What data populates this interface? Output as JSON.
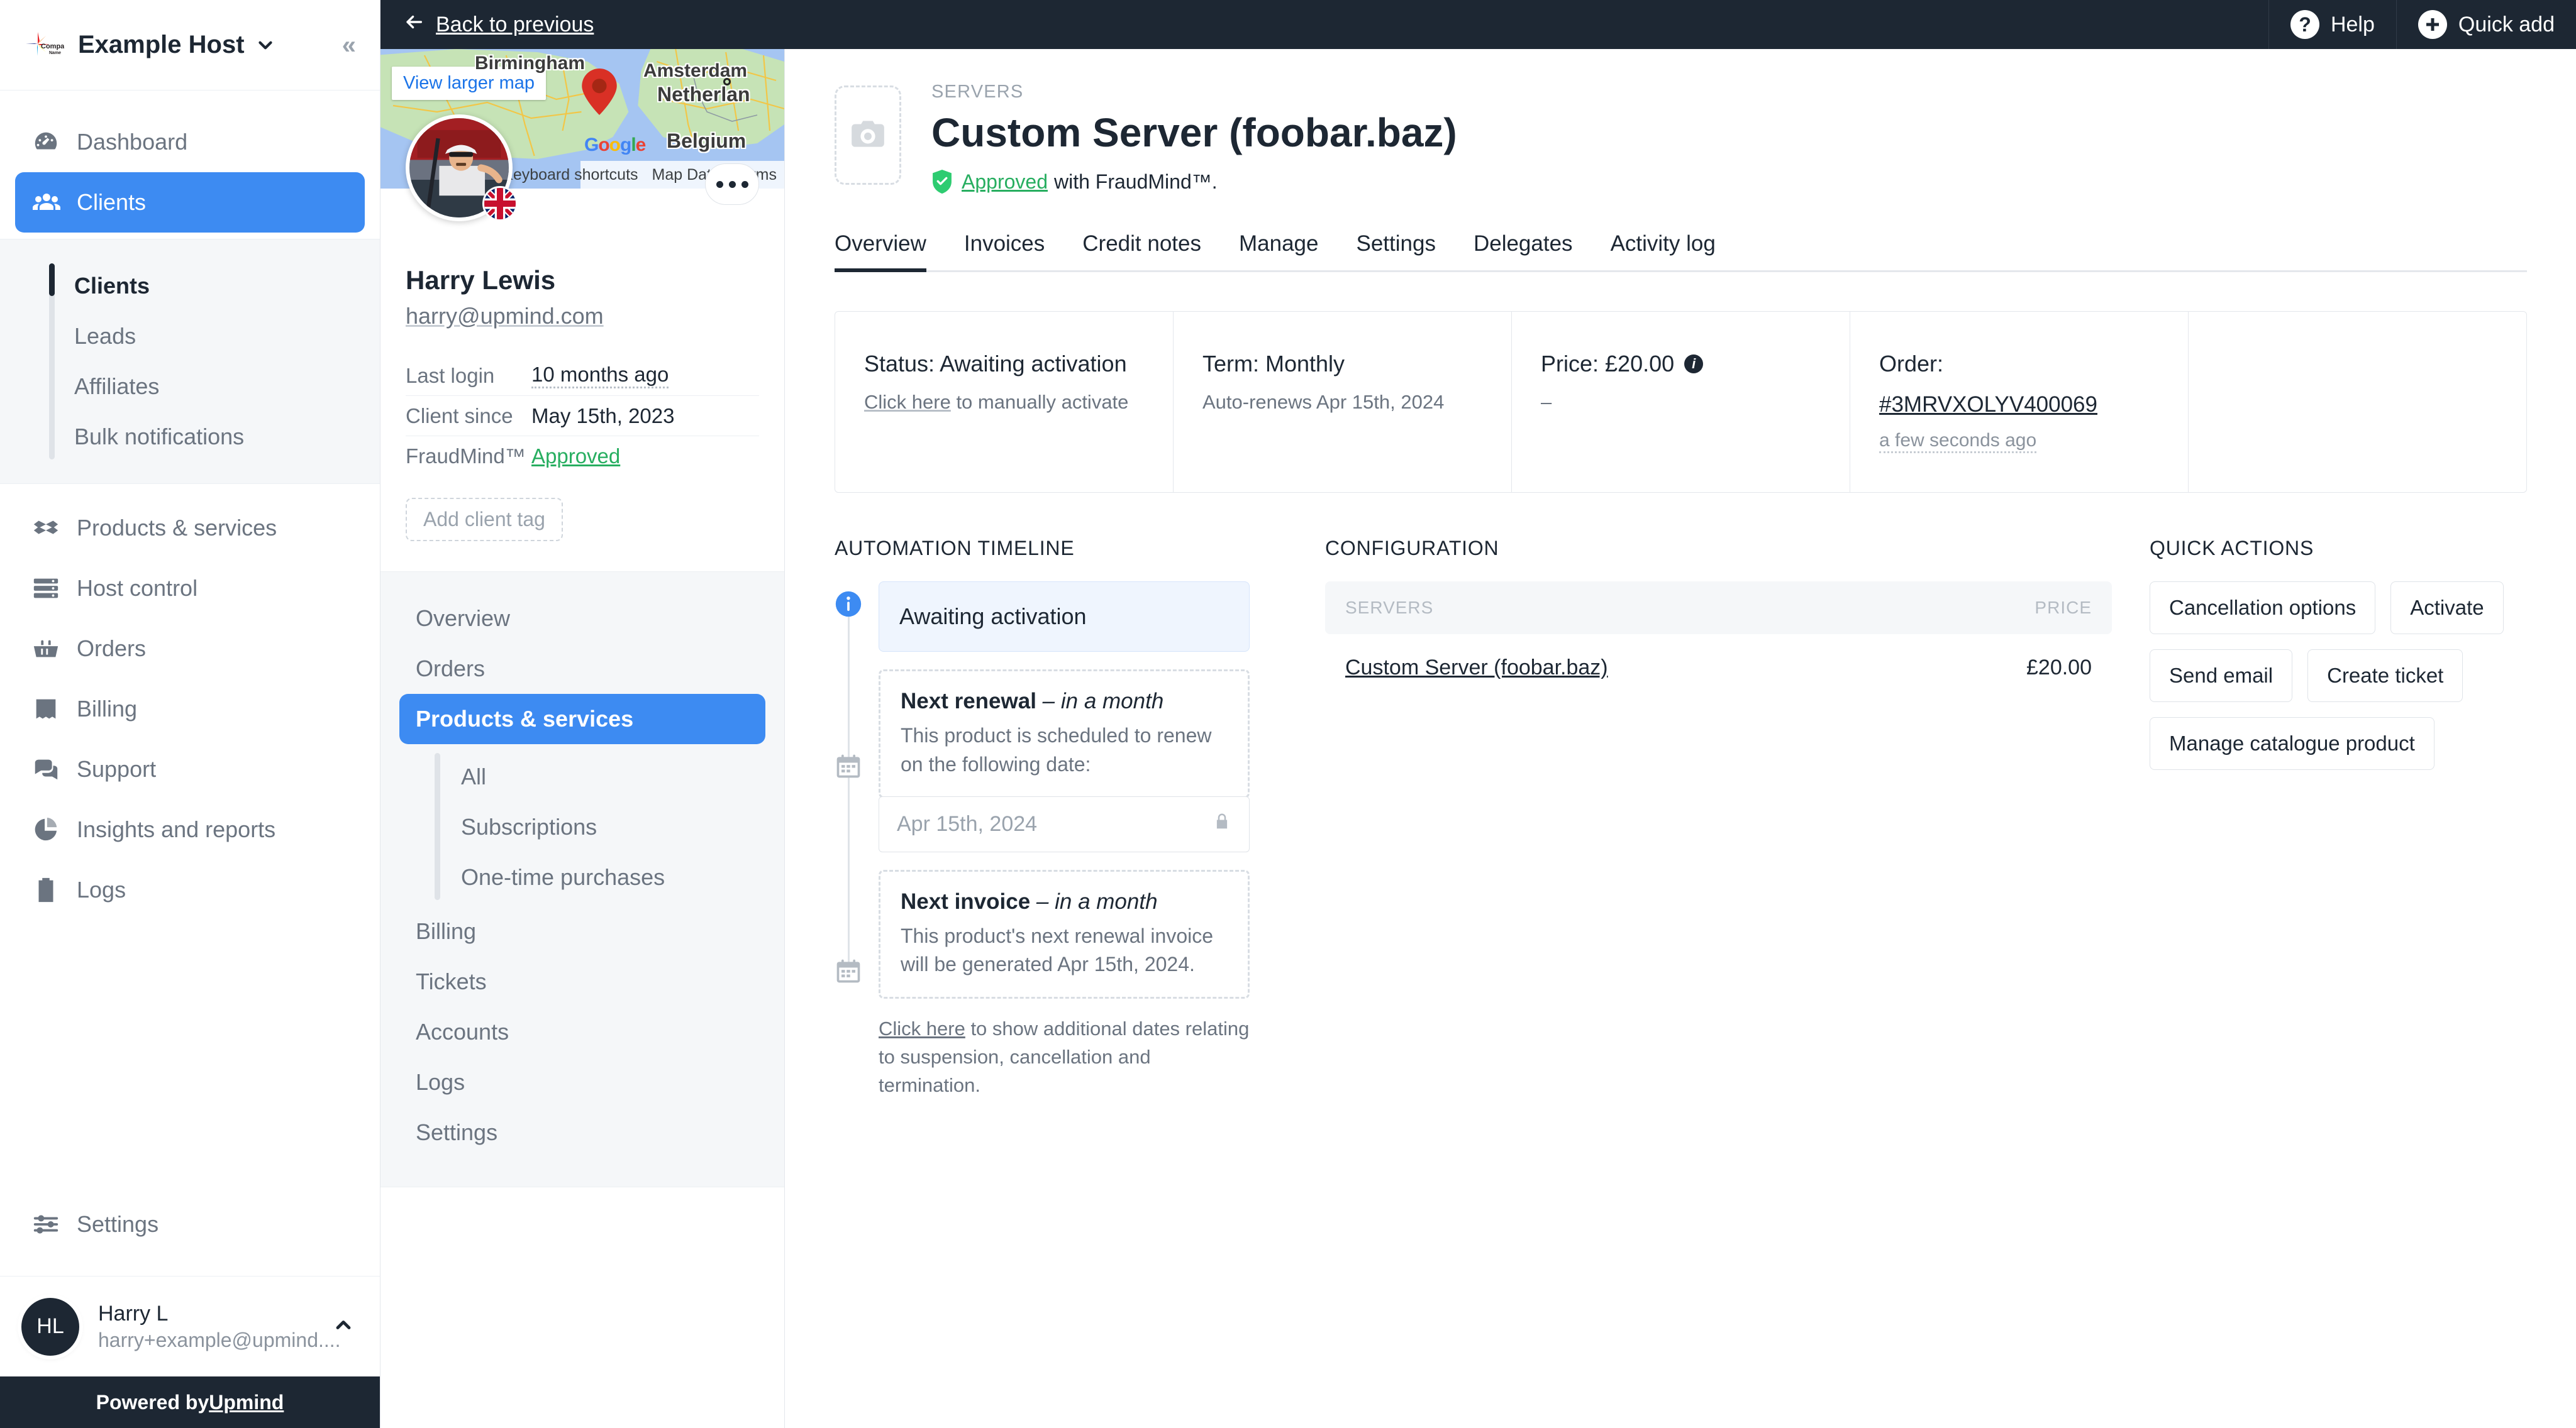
{
  "brand": {
    "logo_text_1": "Company",
    "logo_text_2": "Name"
  },
  "sidebar": {
    "host_name": "Example Host",
    "collapse_icon": "chevron-double-left-icon",
    "items": [
      {
        "label": "Dashboard",
        "icon": "gauge-icon",
        "active": false
      },
      {
        "label": "Clients",
        "icon": "users-icon",
        "active": true
      },
      {
        "label": "Products & services",
        "icon": "box-icon",
        "active": false
      },
      {
        "label": "Host control",
        "icon": "server-icon",
        "active": false
      },
      {
        "label": "Orders",
        "icon": "basket-icon",
        "active": false
      },
      {
        "label": "Billing",
        "icon": "receipt-icon",
        "active": false
      },
      {
        "label": "Support",
        "icon": "chat-icon",
        "active": false
      },
      {
        "label": "Insights and reports",
        "icon": "pie-chart-icon",
        "active": false
      },
      {
        "label": "Logs",
        "icon": "clipboard-list-icon",
        "active": false
      }
    ],
    "sub_items": [
      {
        "label": "Clients",
        "current": true
      },
      {
        "label": "Leads",
        "current": false
      },
      {
        "label": "Affiliates",
        "current": false
      },
      {
        "label": "Bulk notifications",
        "current": false
      }
    ],
    "settings": {
      "label": "Settings",
      "icon": "sliders-icon"
    },
    "user": {
      "initials": "HL",
      "name": "Harry L",
      "email": "harry+example@upmind....",
      "caret": "chevron-up-icon"
    },
    "powered": {
      "prefix": "Powered by ",
      "link": "Upmind"
    }
  },
  "topbar": {
    "back_label": "Back to previous",
    "back_icon": "arrow-left-icon",
    "help_label": "Help",
    "help_icon": "question-circle-icon",
    "quick_add_label": "Quick add",
    "quick_add_icon": "plus-circle-icon"
  },
  "client": {
    "map": {
      "view_larger": "View larger map",
      "cities": [
        "Birmingham",
        "Amsterdam",
        "Netherlan",
        "Belgium"
      ],
      "watermark": "Google",
      "footer": [
        "Keyboard shortcuts",
        "Map Data",
        "Terms"
      ]
    },
    "name": "Harry Lewis",
    "email": "harry@upmind.com",
    "flag": "gb-flag-icon",
    "more_icon": "ellipsis-icon",
    "details": [
      {
        "key": "Last login",
        "value": "10 months ago",
        "style": "dotted"
      },
      {
        "key": "Client since",
        "value": "May 15th, 2023",
        "style": "plain"
      },
      {
        "key": "FraudMind™",
        "value": "Approved",
        "style": "approved"
      }
    ],
    "add_tag": "Add client tag",
    "nav": [
      {
        "label": "Overview",
        "active": false
      },
      {
        "label": "Orders",
        "active": false
      },
      {
        "label": "Products & services",
        "active": true
      }
    ],
    "nav_sub": [
      "All",
      "Subscriptions",
      "One-time purchases"
    ],
    "nav_rest": [
      {
        "label": "Billing"
      },
      {
        "label": "Tickets"
      },
      {
        "label": "Accounts"
      },
      {
        "label": "Logs"
      },
      {
        "label": "Settings"
      }
    ]
  },
  "product": {
    "eyebrow": "SERVERS",
    "title": "Custom Server (foobar.baz)",
    "thumb_icon": "camera-placeholder-icon",
    "fraud_icon": "shield-check-icon",
    "fraud_link": "Approved",
    "fraud_suffix": "with FraudMind™.",
    "tabs": [
      {
        "label": "Overview",
        "active": true
      },
      {
        "label": "Invoices",
        "active": false
      },
      {
        "label": "Credit notes",
        "active": false
      },
      {
        "label": "Manage",
        "active": false
      },
      {
        "label": "Settings",
        "active": false
      },
      {
        "label": "Delegates",
        "active": false
      },
      {
        "label": "Activity log",
        "active": false
      }
    ]
  },
  "stats": {
    "status_title": "Status: Awaiting activation",
    "status_link": "Click here",
    "status_rest": " to manually activate",
    "term_title": "Term: Monthly",
    "term_sub": "Auto-renews Apr 15th, 2024",
    "price_title": "Price: £20.00",
    "price_info_icon": "info-icon",
    "price_sub": "–",
    "order_title": "Order:",
    "order_number": "#3MRVXOLYV400069",
    "order_time": "a few seconds ago"
  },
  "timeline": {
    "section_title": "AUTOMATION TIMELINE",
    "status_badge": "Awaiting activation",
    "status_icon": "info-circle-icon",
    "renewal": {
      "icon": "calendar-icon",
      "title": "Next renewal",
      "title_em": " – in a month",
      "text": "This product is scheduled to renew on the following date:",
      "date_value": "Apr 15th, 2024",
      "lock_icon": "lock-icon"
    },
    "invoice": {
      "icon": "calendar-icon",
      "title": "Next invoice",
      "title_em": " – in a month",
      "text": "This product's next renewal invoice will be generated Apr 15th, 2024."
    },
    "note_link": "Click here",
    "note_rest": " to show additional dates relating to suspension, cancellation and termination."
  },
  "configuration": {
    "section_title": "CONFIGURATION",
    "columns": [
      "SERVERS",
      "PRICE"
    ],
    "rows": [
      {
        "name": "Custom Server (foobar.baz)",
        "price": "£20.00"
      }
    ]
  },
  "quick_actions": {
    "section_title": "QUICK ACTIONS",
    "buttons": [
      "Cancellation options",
      "Activate",
      "Send email",
      "Create ticket",
      "Manage catalogue product"
    ]
  },
  "colors": {
    "accent_blue": "#3d8bf2",
    "dark": "#1d2733",
    "green": "#27ae60",
    "muted": "#6b7480"
  }
}
